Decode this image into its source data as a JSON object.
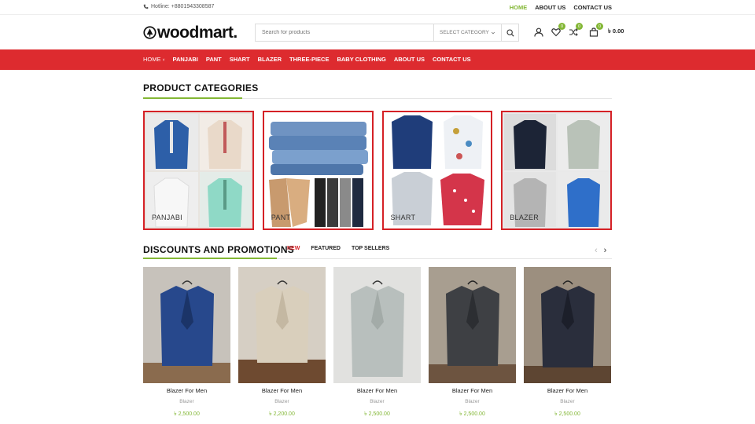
{
  "topbar": {
    "hotline": "Hotline: +8801943308587",
    "links": [
      {
        "label": "HOME",
        "active": true
      },
      {
        "label": "ABOUT US",
        "active": false
      },
      {
        "label": "CONTACT US",
        "active": false
      }
    ]
  },
  "header": {
    "logo": "woodmart.",
    "search_placeholder": "Search for products",
    "category_select": "SELECT CATEGORY",
    "compare_count": "0",
    "wishlist_count": "0",
    "cart_count": "0",
    "cart_total": "৳ 0.00"
  },
  "nav": {
    "items": [
      "HOME",
      "PANJABI",
      "PANT",
      "SHART",
      "BLAZER",
      "THREE-PIECE",
      "BABY CLOTHING",
      "ABOUT US",
      "CONTACT US"
    ]
  },
  "categories": {
    "title": "PRODUCT CATEGORIES",
    "items": [
      {
        "label": "PANJABI"
      },
      {
        "label": "PANT"
      },
      {
        "label": "SHART"
      },
      {
        "label": "BLAZER"
      }
    ]
  },
  "promotions": {
    "title": "DISCOUNTS AND PROMOTIONS",
    "tabs": [
      "NEW",
      "FEATURED",
      "TOP SELLERS"
    ],
    "products": [
      {
        "name": "Blazer For Men",
        "category": "Blazer",
        "price": "৳ 2,500.00"
      },
      {
        "name": "Blazer For Men",
        "category": "Blazer",
        "price": "৳ 2,200.00"
      },
      {
        "name": "Blazer For Men",
        "category": "Blazer",
        "price": "৳ 2,500.00"
      },
      {
        "name": "Blazer For Men",
        "category": "Blazer",
        "price": "৳ 2,500.00"
      },
      {
        "name": "Blazer For Men",
        "category": "Blazer",
        "price": "৳ 2,500.00"
      }
    ]
  },
  "colors": {
    "accent_green": "#83b735",
    "nav_red": "#dd2b2f",
    "card_border_red": "#d52126"
  }
}
